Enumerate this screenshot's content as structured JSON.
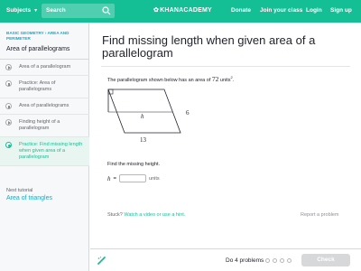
{
  "header": {
    "subjects_label": "Subjects",
    "search_placeholder": "Search",
    "logo_text": "KHANACADEMY",
    "donate": "Donate",
    "join_class": "Join your class",
    "login": "Login",
    "signup": "Sign up"
  },
  "sidebar": {
    "breadcrumb": "BASIC GEOMETRY › AREA AND PERIMETER",
    "title": "Area of parallelograms",
    "items": [
      {
        "label": "Area of a parallelogram",
        "kind": "play"
      },
      {
        "label": "Practice: Area of parallelograms",
        "kind": "pencil"
      },
      {
        "label": "Area of parallelograms",
        "kind": "pencil"
      },
      {
        "label": "Finding height of a parallelogram",
        "kind": "play"
      },
      {
        "label": "Practice: Find missing length when given area of a parallelogram",
        "kind": "active"
      }
    ],
    "next_label": "Next tutorial",
    "next_link": "Area of triangles"
  },
  "main": {
    "title": "Find missing length when given area of a parallelogram",
    "prompt_before": "The parallelogram shown below has an area of",
    "prompt_value": "72",
    "prompt_units": "units",
    "prompt_exp": "2",
    "prompt_end": ".",
    "figure": {
      "h_label": "h",
      "base_label": "13",
      "side_label": "6"
    },
    "find_label": "Find the missing height.",
    "answer_var": "h",
    "answer_eq": "=",
    "answer_units": "units",
    "stuck_label": "Stuck?",
    "hint_link": "Watch a video or use a hint.",
    "report_link": "Report a problem"
  },
  "footer": {
    "problems_label": "Do 4 problems",
    "check_label": "Check"
  },
  "colors": {
    "brand": "#14bf96",
    "link": "#11accd"
  }
}
